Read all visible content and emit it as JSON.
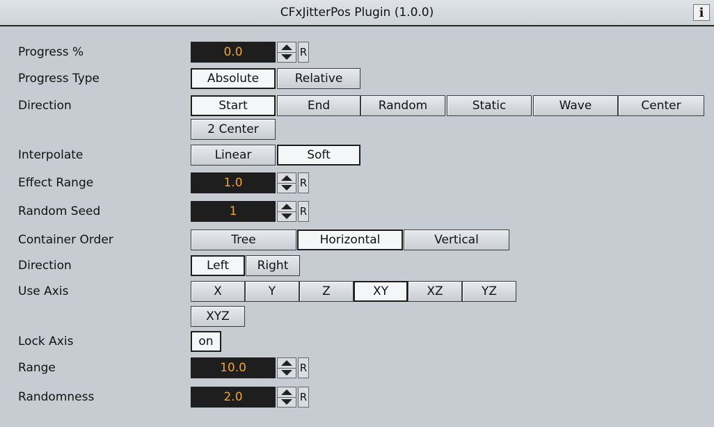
{
  "title": "CFxJitterPos Plugin (1.0.0)",
  "info_label": "i",
  "rows": {
    "progress": {
      "label": "Progress %",
      "value": "0.0",
      "reset": "R"
    },
    "progress_type": {
      "label": "Progress Type",
      "options": [
        "Absolute",
        "Relative"
      ],
      "selected": "Absolute"
    },
    "direction": {
      "label": "Direction",
      "options": [
        "Start",
        "End",
        "Random",
        "Static",
        "Wave",
        "Center",
        "2 Center"
      ],
      "selected": "Start"
    },
    "interpolate": {
      "label": "Interpolate",
      "options": [
        "Linear",
        "Soft"
      ],
      "selected": "Soft"
    },
    "effect_range": {
      "label": "Effect Range",
      "value": "1.0",
      "reset": "R"
    },
    "random_seed": {
      "label": "Random Seed",
      "value": "1",
      "reset": "R"
    },
    "container_order": {
      "label": "Container Order",
      "options": [
        "Tree",
        "Horizontal",
        "Vertical"
      ],
      "selected": "Horizontal"
    },
    "direction2": {
      "label": "Direction",
      "options": [
        "Left",
        "Right"
      ],
      "selected": "Left"
    },
    "use_axis": {
      "label": "Use Axis",
      "options": [
        "X",
        "Y",
        "Z",
        "XY",
        "XZ",
        "YZ",
        "XYZ"
      ],
      "selected": "XY"
    },
    "lock_axis": {
      "label": "Lock Axis",
      "value": "on"
    },
    "range": {
      "label": "Range",
      "value": "10.0",
      "reset": "R"
    },
    "randomness": {
      "label": "Randomness",
      "value": "2.0",
      "reset": "R"
    }
  },
  "colors": {
    "background": "#c6ccd2",
    "value_bg": "#1e1e1e",
    "value_text": "#f3a52b"
  }
}
